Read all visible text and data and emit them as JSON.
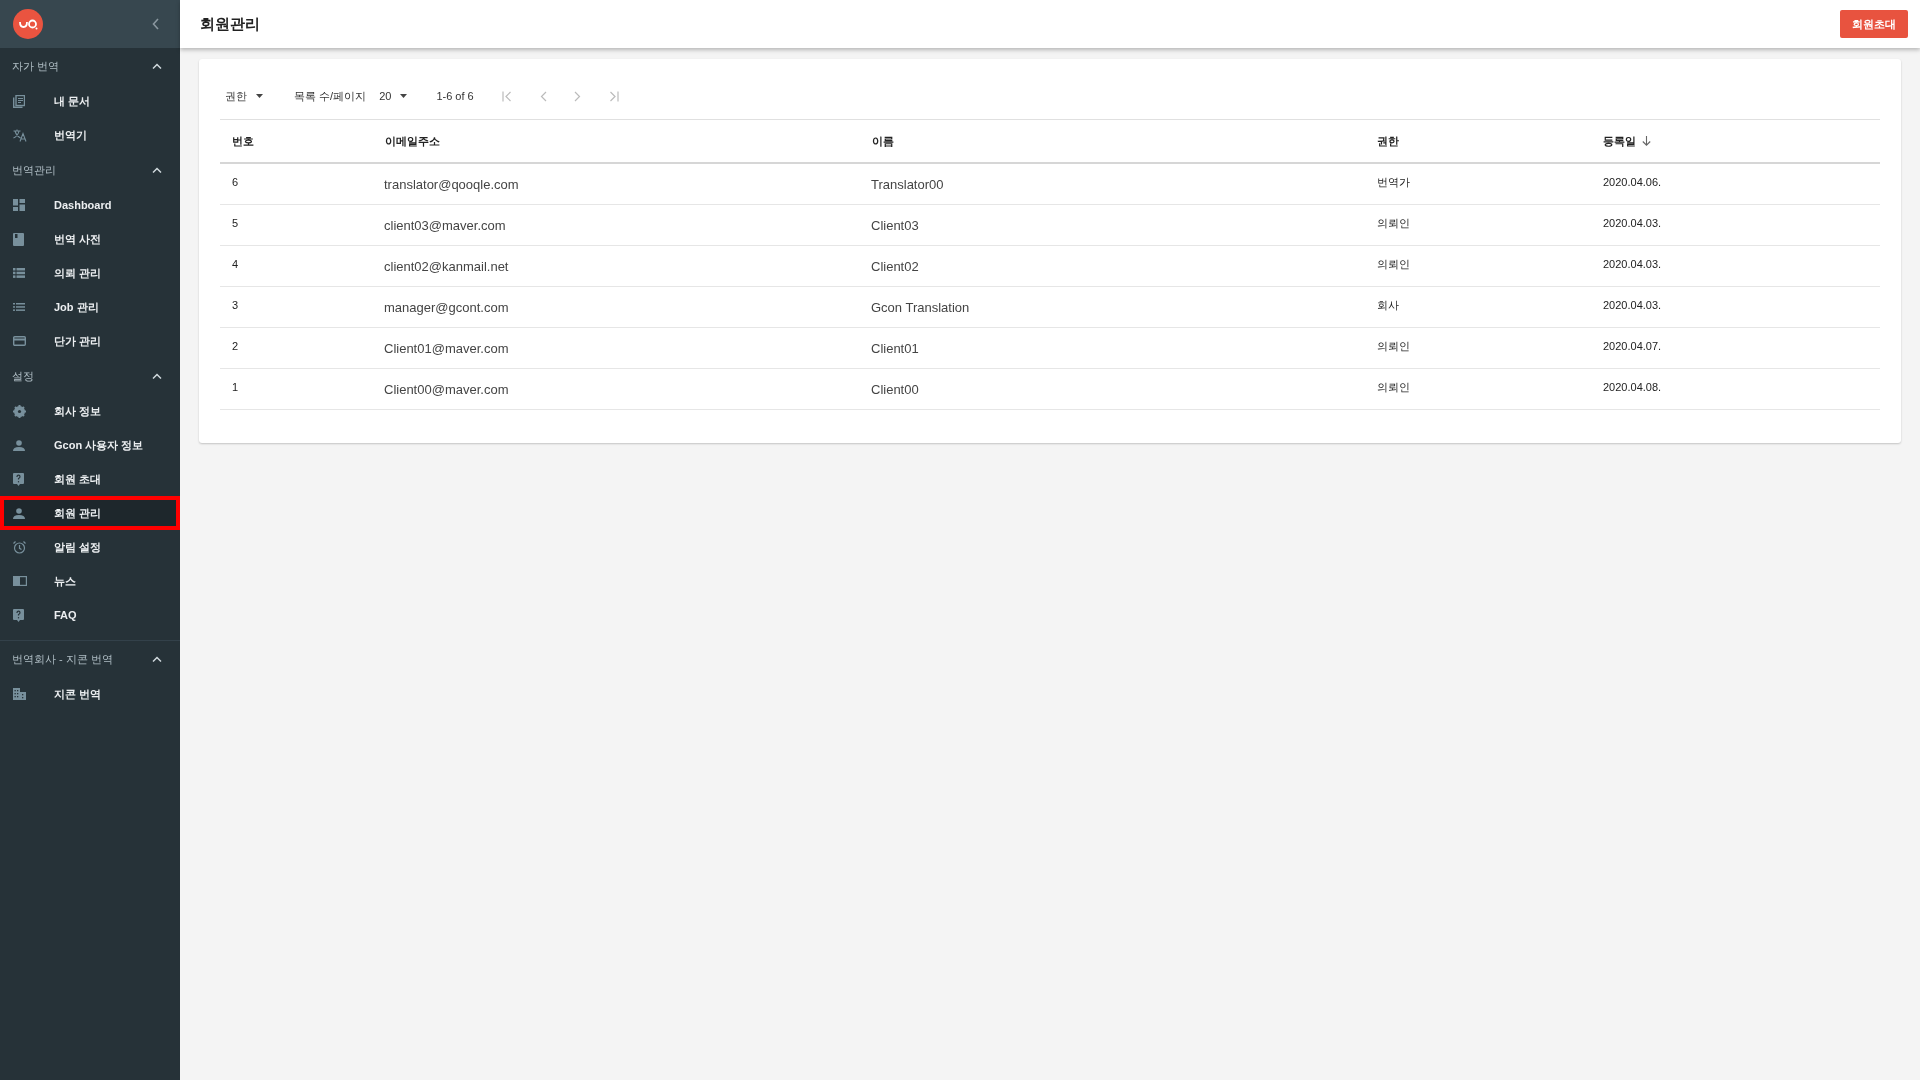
{
  "header": {
    "title": "회원관리",
    "action_button": "회원초대"
  },
  "sidebar": {
    "sections": [
      {
        "title": "자가 번역",
        "expanded": true,
        "items": [
          {
            "label": "내 문서",
            "selected": false
          },
          {
            "label": "번역기",
            "selected": false
          }
        ]
      },
      {
        "title": "번역관리",
        "expanded": true,
        "items": [
          {
            "label": "Dashboard",
            "selected": false
          },
          {
            "label": "번역 사전",
            "selected": false
          },
          {
            "label": "의뢰 관리",
            "selected": false
          },
          {
            "label": "Job 관리",
            "selected": false
          },
          {
            "label": "단가 관리",
            "selected": false
          }
        ]
      },
      {
        "title": "설정",
        "expanded": true,
        "items": [
          {
            "label": "회사 정보",
            "selected": false
          },
          {
            "label": "Gcon 사용자 정보",
            "selected": false
          },
          {
            "label": "회원 초대",
            "selected": false
          },
          {
            "label": "회원 관리",
            "selected": true
          },
          {
            "label": "알림 설정",
            "selected": false
          },
          {
            "label": "뉴스",
            "selected": false
          },
          {
            "label": "FAQ",
            "selected": false
          }
        ]
      },
      {
        "title": "번역회사 - 지콘 번역",
        "expanded": true,
        "items": [
          {
            "label": "지콘 번역",
            "selected": false
          }
        ]
      }
    ]
  },
  "toolbar": {
    "filter_label": "권한",
    "page_size_label": "목록 수/페이지",
    "page_size": "20",
    "range": "1-6 of 6"
  },
  "table": {
    "columns": [
      {
        "label": "번호",
        "sorted": false
      },
      {
        "label": "이메일주소",
        "sorted": false
      },
      {
        "label": "이름",
        "sorted": false
      },
      {
        "label": "권한",
        "sorted": false
      },
      {
        "label": "등록일",
        "sorted": true
      }
    ],
    "rows": [
      [
        "6",
        "translator@qooqle.com",
        "Translator00",
        "번역가",
        "2020.04.06."
      ],
      [
        "5",
        "client03@maver.com",
        "Client03",
        "의뢰인",
        "2020.04.03."
      ],
      [
        "4",
        "client02@kanmail.net",
        "Client02",
        "의뢰인",
        "2020.04.03."
      ],
      [
        "3",
        "manager@gcont.com",
        "Gcon Translation",
        "회사",
        "2020.04.03."
      ],
      [
        "2",
        "Client01@maver.com",
        "Client01",
        "의뢰인",
        "2020.04.07."
      ],
      [
        "1",
        "Client00@maver.com",
        "Client00",
        "의뢰인",
        "2020.04.08."
      ]
    ]
  }
}
